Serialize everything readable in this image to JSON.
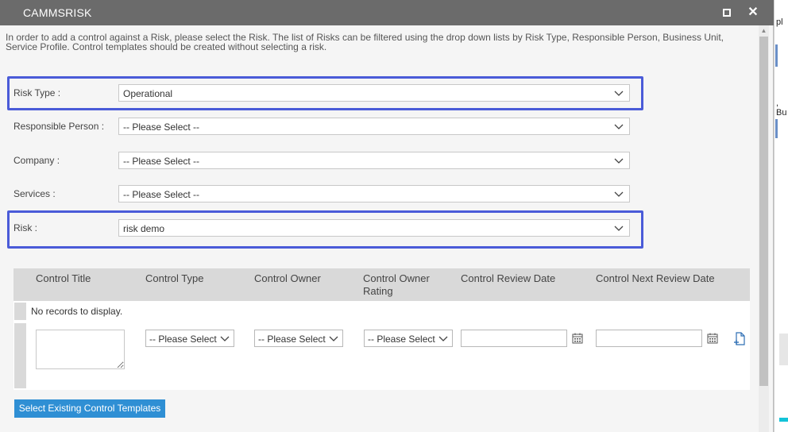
{
  "window": {
    "title": "CAMMSRISK"
  },
  "intro_text": "In order to add a control against a Risk, please select the Risk. The list of Risks can be filtered using the drop down lists by Risk Type, Responsible Person, Business Unit, Service Profile. Control templates should be created without selecting a risk.",
  "fields": {
    "risk_type": {
      "label": "Risk Type :",
      "value": "Operational"
    },
    "responsible_person": {
      "label": "Responsible Person :",
      "value": "-- Please Select --"
    },
    "company": {
      "label": "Company :",
      "value": "-- Please Select --"
    },
    "services": {
      "label": "Services :",
      "value": "-- Please Select --"
    },
    "risk": {
      "label": "Risk :",
      "value": "risk demo"
    }
  },
  "grid": {
    "columns": [
      "Control Title",
      "Control Type",
      "Control Owner",
      "Control Owner Rating",
      "Control Review Date",
      "Control Next Review Date"
    ],
    "empty_text": "No records to display.",
    "new_row": {
      "control_type": "-- Please Select",
      "control_owner": "-- Please Select",
      "owner_rating": "-- Please Select",
      "review_date": "",
      "next_review_date": ""
    }
  },
  "buttons": {
    "select_templates": "Select Existing Control Templates"
  },
  "background_window": {
    "text1": "pl",
    "text2": ", Bu"
  },
  "colors": {
    "titlebar": "#6b6b6b",
    "highlight": "#4a5bd8",
    "button": "#2f8fd4",
    "grid_header": "#d9d9d9"
  },
  "icons": [
    "maximize-icon",
    "close-icon",
    "chevron-down-icon",
    "calendar-icon",
    "add-document-icon"
  ]
}
